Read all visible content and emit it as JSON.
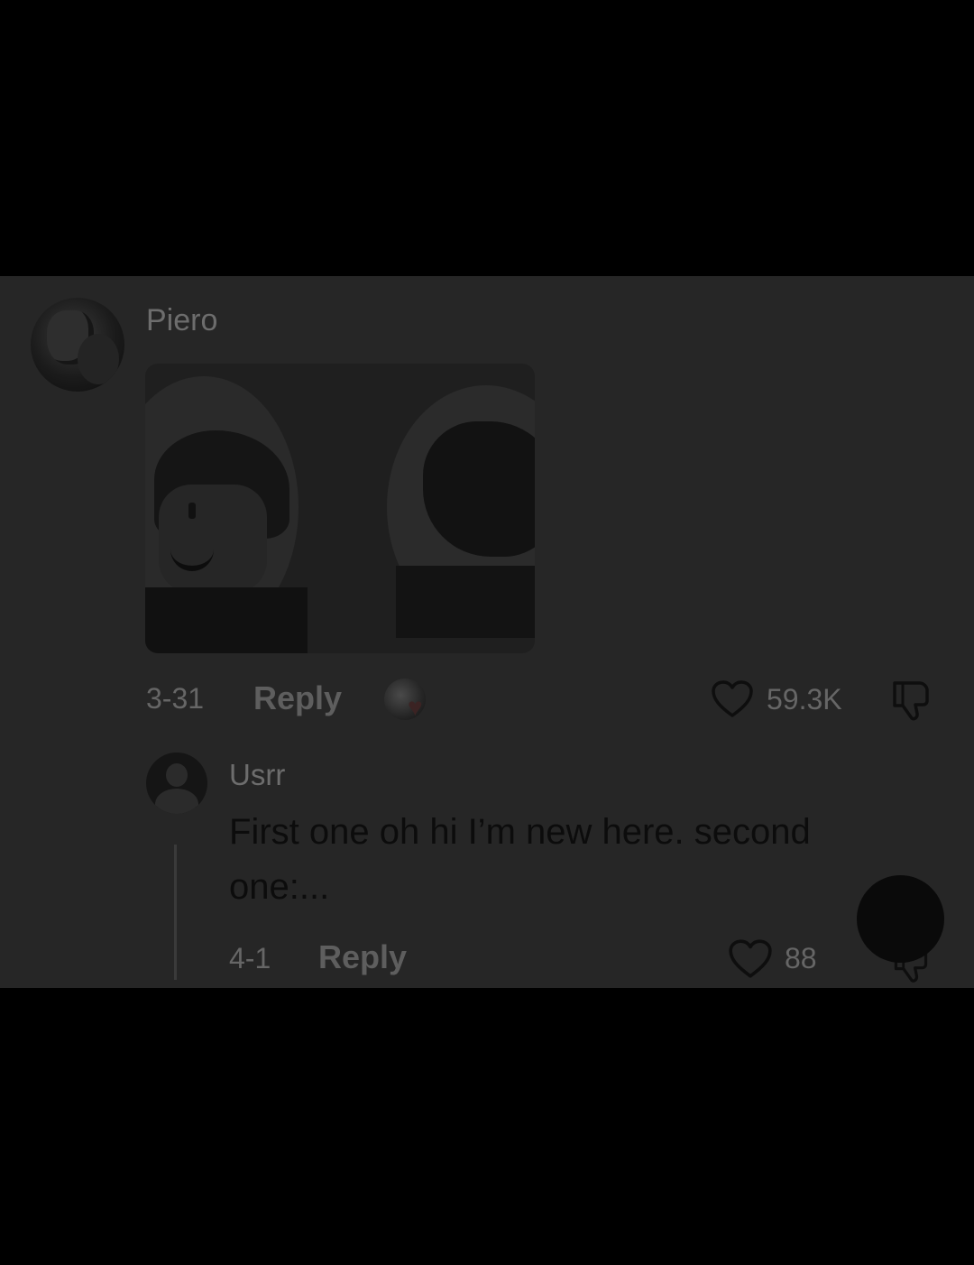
{
  "comment": {
    "username": "Piero",
    "date": "3-31",
    "reply_label": "Reply",
    "likes": "59.3K"
  },
  "reply_comment": {
    "username": "Usrr",
    "text": "First one oh hi I’m new here. second one:...",
    "date": "4-1",
    "reply_label": "Reply",
    "likes": "88"
  },
  "icons": {
    "like": "heart-outline-icon",
    "dislike": "thumbs-down-icon",
    "creator_like": "creator-liked-badge-icon"
  },
  "colors": {
    "background": "#262626",
    "letterbox": "#000000",
    "text_primary": "#0c0c0c",
    "text_secondary": "#666666"
  }
}
